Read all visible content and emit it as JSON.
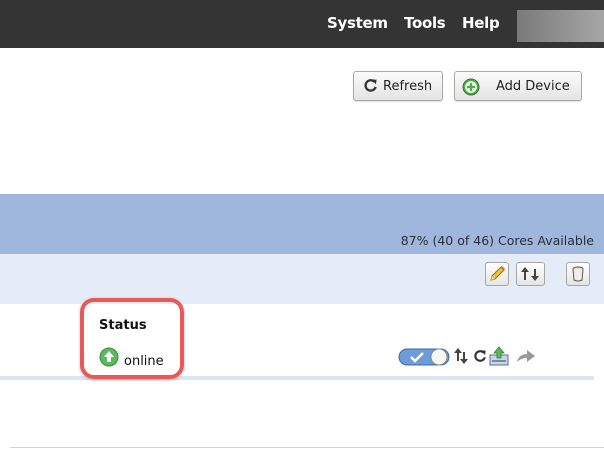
{
  "menu": {
    "system": "System",
    "tools": "Tools",
    "help": "Help"
  },
  "toolbar": {
    "refresh_label": "Refresh",
    "add_device_label": "Add Device"
  },
  "summary": {
    "cores_text": "87% (40 of 46) Cores Available"
  },
  "device": {
    "status_header": "Status",
    "status_value": "online"
  },
  "icons": {
    "refresh": "refresh-icon",
    "add": "add-circle-icon",
    "edit": "pencil-icon",
    "move": "move-arrows-icon",
    "delete": "trash-icon",
    "status": "online-arrow-icon",
    "toggle": "toggle-switch",
    "sync": "sync-arrows-icon",
    "reload": "reload-icon",
    "download": "download-icon",
    "forward": "forward-arrow-icon"
  },
  "colors": {
    "topbar": "#343434",
    "band": "#9fb7dd",
    "toolrow": "#e5ecf8",
    "highlight": "#e85a55",
    "online": "#5cb85c"
  }
}
